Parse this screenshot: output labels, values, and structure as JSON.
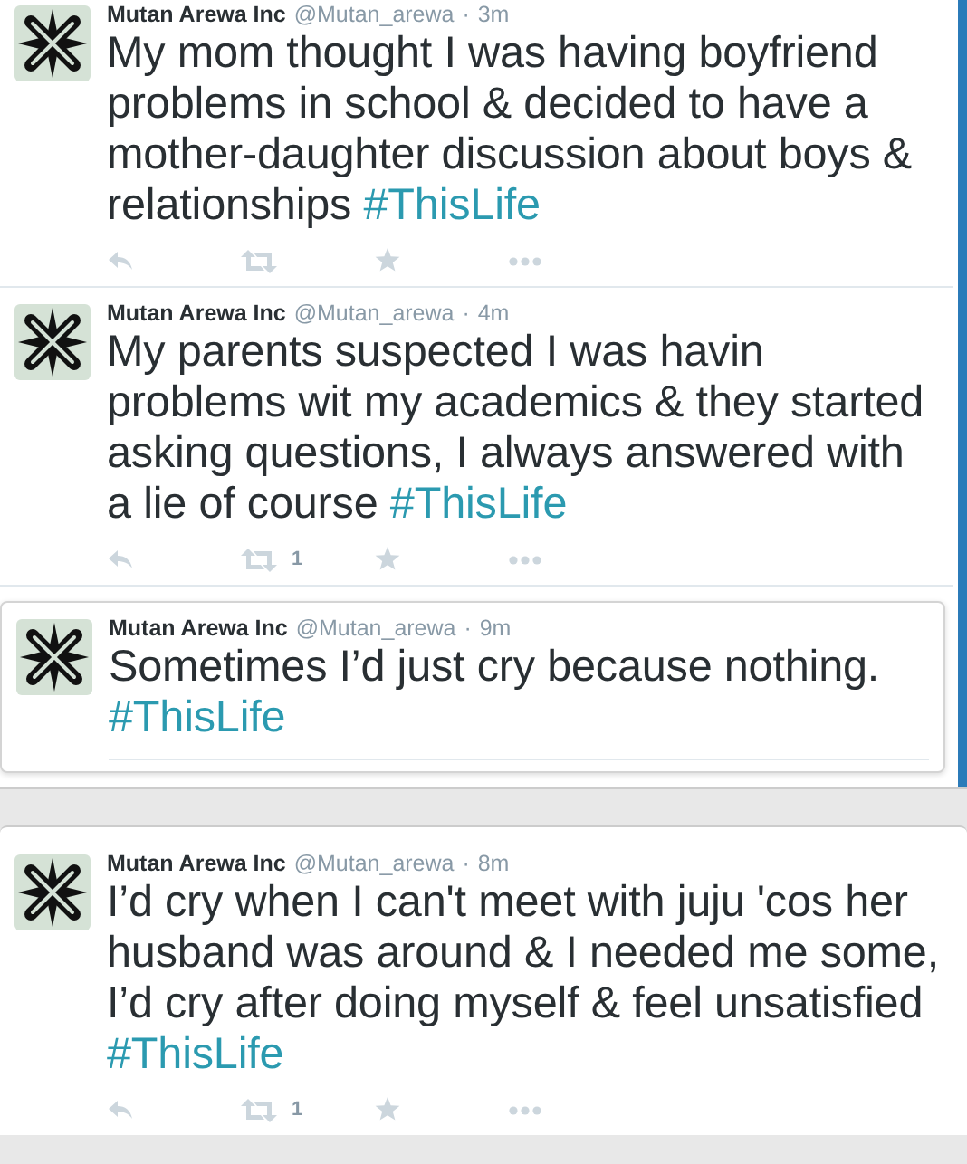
{
  "tweets": [
    {
      "kind": "row",
      "name": "Mutan Arewa Inc",
      "handle": "@Mutan_arewa",
      "separator": "·",
      "time": "3m",
      "text": "My mom thought I was having boyfriend problems in school & decided to have a mother-daughter discussion about boys & relationships",
      "hashtag": "#ThisLife",
      "actions": true
    },
    {
      "kind": "row",
      "name": "Mutan Arewa Inc",
      "handle": "@Mutan_arewa",
      "separator": "·",
      "time": "4m",
      "text": "My parents suspected I was havin problems wit my academics & they started asking questions, I always answered with a lie of course",
      "hashtag": "#ThisLife",
      "actions": true,
      "retweet_count": "1"
    },
    {
      "kind": "card",
      "name": "Mutan Arewa Inc",
      "handle": "@Mutan_arewa",
      "separator": "·",
      "time": "9m",
      "text": "Sometimes I’d just cry because nothing.",
      "hashtag": "#ThisLife",
      "actions": false
    },
    {
      "kind": "separate",
      "name": "Mutan Arewa Inc",
      "handle": "@Mutan_arewa",
      "separator": "·",
      "time": "8m",
      "text": "I’d cry when I can't meet with juju 'cos her husband was around & I needed me some, I’d cry after doing myself & feel unsatisfied",
      "hashtag": "#ThisLife",
      "actions": true,
      "retweet_count": "1"
    }
  ]
}
